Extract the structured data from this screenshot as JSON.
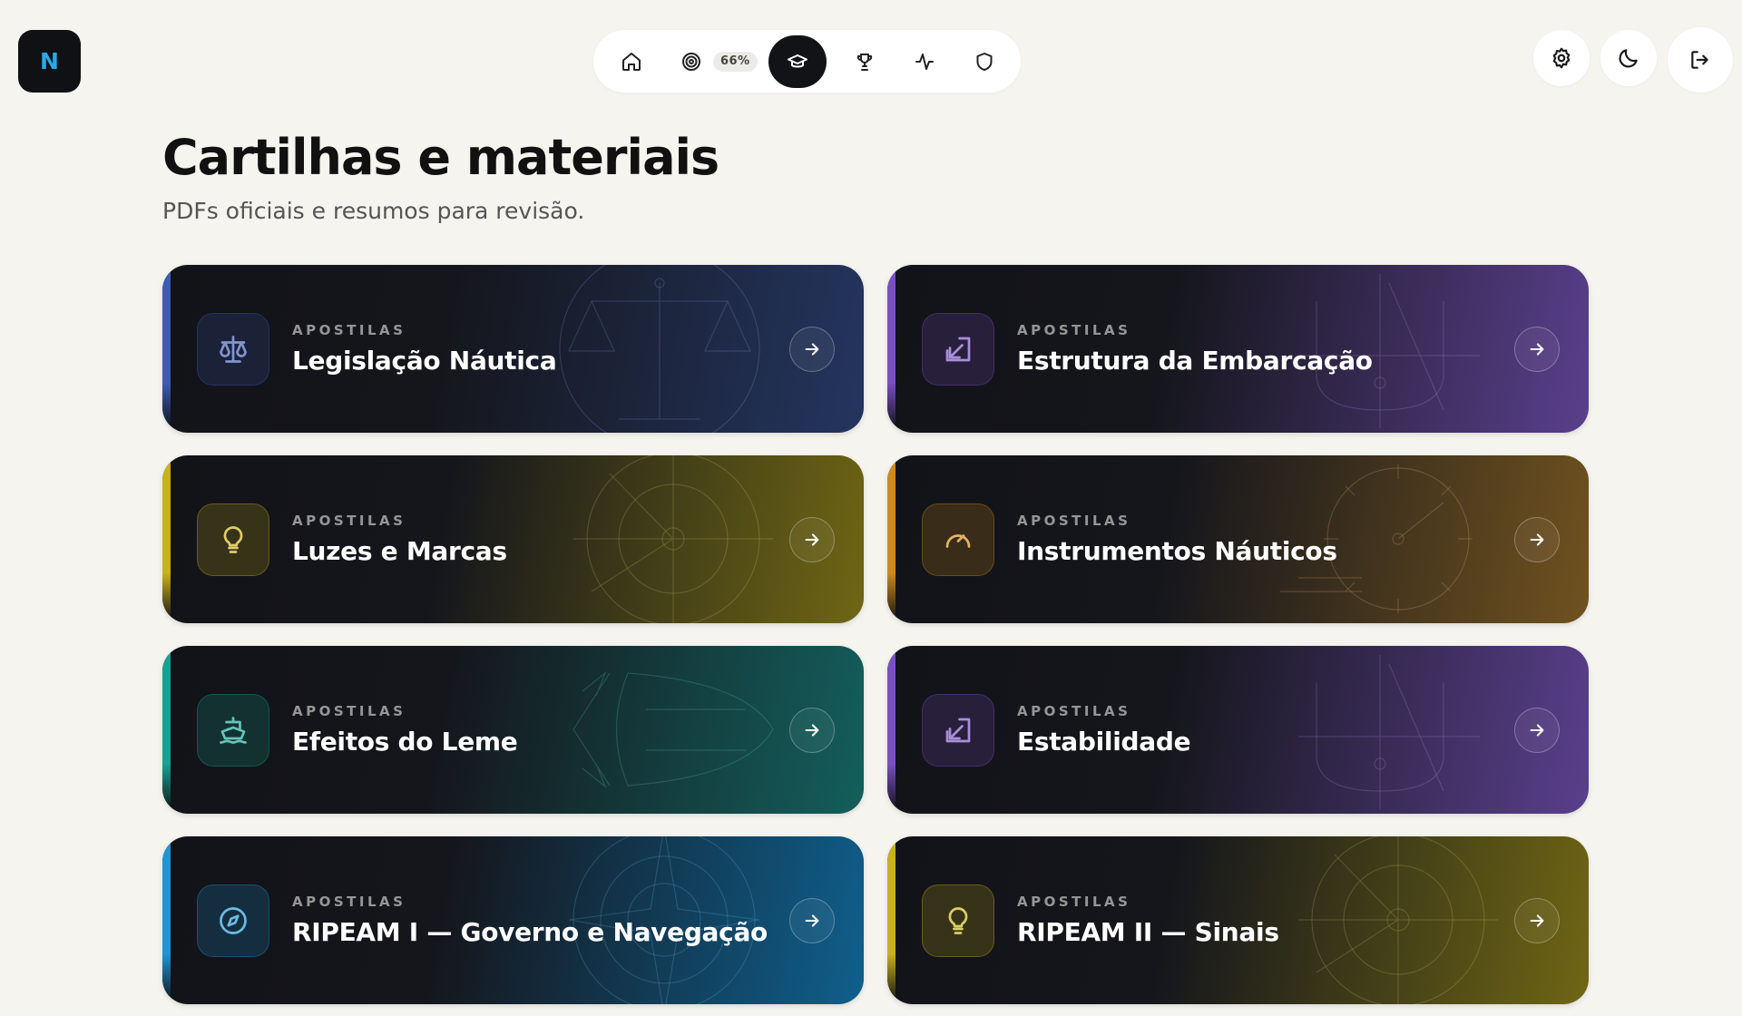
{
  "logo": {
    "letter": "N"
  },
  "nav": {
    "progress_badge": "66%",
    "items": [
      {
        "name": "home",
        "icon": "home-icon"
      },
      {
        "name": "goals",
        "icon": "target-icon"
      },
      {
        "name": "materials",
        "icon": "graduation-cap-icon",
        "active": true
      },
      {
        "name": "ranking",
        "icon": "trophy-icon"
      },
      {
        "name": "activity",
        "icon": "activity-icon"
      },
      {
        "name": "security",
        "icon": "shield-icon"
      }
    ]
  },
  "actions": [
    {
      "name": "settings",
      "icon": "gear-icon"
    },
    {
      "name": "theme",
      "icon": "moon-icon"
    },
    {
      "name": "logout",
      "icon": "logout-icon"
    }
  ],
  "page": {
    "title": "Cartilhas e materiais",
    "subtitle": "PDFs oficiais e resumos para revisão."
  },
  "cards": [
    {
      "kicker": "APOSTILAS",
      "title": "Legislação Náutica",
      "icon": "scale-icon",
      "accent": "#3d5bb5",
      "gradient": "#24355f"
    },
    {
      "kicker": "APOSTILAS",
      "title": "Estrutura da Embarcação",
      "icon": "external-in-icon",
      "accent": "#7b4fc4",
      "gradient": "#5a3f8c"
    },
    {
      "kicker": "APOSTILAS",
      "title": "Luzes e Marcas",
      "icon": "lightbulb-icon",
      "accent": "#c9b11a",
      "gradient": "#6f6614"
    },
    {
      "kicker": "APOSTILAS",
      "title": "Instrumentos Náuticos",
      "icon": "gauge-icon",
      "accent": "#d08a1a",
      "gradient": "#70521f"
    },
    {
      "kicker": "APOSTILAS",
      "title": "Efeitos do Leme",
      "icon": "ship-icon",
      "accent": "#14a392",
      "gradient": "#135f5c"
    },
    {
      "kicker": "APOSTILAS",
      "title": "Estabilidade",
      "icon": "external-in-icon",
      "accent": "#7b4fc4",
      "gradient": "#5a3f8c"
    },
    {
      "kicker": "APOSTILAS",
      "title": "RIPEAM I — Governo e Navegação",
      "icon": "compass-icon",
      "accent": "#1e95d6",
      "gradient": "#0f5f8c"
    },
    {
      "kicker": "APOSTILAS",
      "title": "RIPEAM II — Sinais",
      "icon": "lightbulb-icon",
      "accent": "#c9b11a",
      "gradient": "#6f6614"
    }
  ]
}
